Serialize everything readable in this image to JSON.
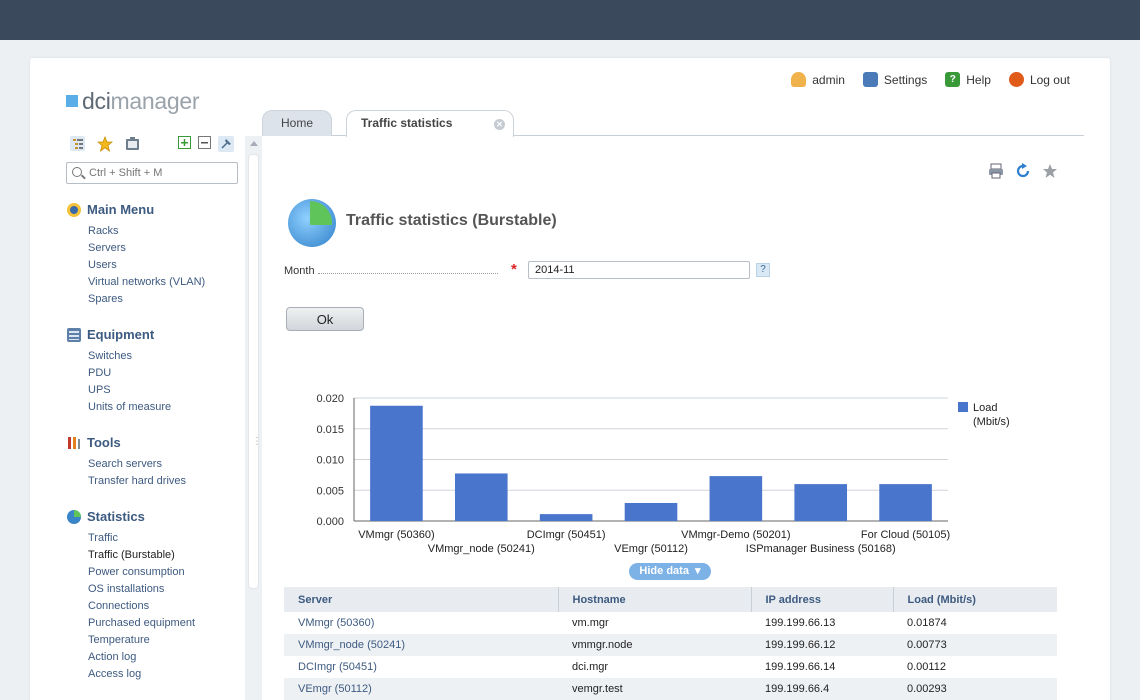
{
  "app": {
    "logo_dci": "dci",
    "logo_manager": "manager"
  },
  "usernav": {
    "user": "admin",
    "settings": "Settings",
    "help": "Help",
    "logout": "Log out"
  },
  "sidebar": {
    "search_placeholder": "Ctrl + Shift + M",
    "groups": [
      {
        "title": "Main Menu",
        "items": [
          "Racks",
          "Servers",
          "Users",
          "Virtual networks (VLAN)",
          "Spares"
        ]
      },
      {
        "title": "Equipment",
        "items": [
          "Switches",
          "PDU",
          "UPS",
          "Units of measure"
        ]
      },
      {
        "title": "Tools",
        "items": [
          "Search servers",
          "Transfer hard drives"
        ]
      },
      {
        "title": "Statistics",
        "items": [
          "Traffic",
          "Traffic (Burstable)",
          "Power consumption",
          "OS installations",
          "Connections",
          "Purchased equipment",
          "Temperature",
          "Action log",
          "Access log"
        ]
      }
    ],
    "active_item": "Traffic (Burstable)"
  },
  "tabs": {
    "home": "Home",
    "current": "Traffic statistics (Burst..."
  },
  "page": {
    "title": "Traffic statistics (Burstable)",
    "month_label": "Month",
    "month_value": "2014-11",
    "help_mark": "?",
    "ok_label": "Ok",
    "hide_data_label": "Hide data"
  },
  "chart_data": {
    "type": "bar",
    "categories": [
      "VMmgr (50360)",
      "VMmgr_node (50241)",
      "DCImgr (50451)",
      "VEmgr (50112)",
      "VMmgr-Demo (50201)",
      "ISPmanager Business (50168)",
      "For Cloud (50105)"
    ],
    "series": [
      {
        "name": "Load (Mbit/s)",
        "values": [
          0.01874,
          0.00773,
          0.00112,
          0.00293,
          0.0073,
          0.006,
          0.006
        ]
      }
    ],
    "yticks": [
      "0.000",
      "0.005",
      "0.010",
      "0.015",
      "0.020"
    ],
    "ylim": [
      0,
      0.02
    ],
    "legend_lines": [
      "Load",
      "(Mbit/s)"
    ],
    "bar_color": "#4a75cc",
    "grid": true,
    "legend_position": "right"
  },
  "table": {
    "headers": [
      "Server",
      "Hostname",
      "IP address",
      "Load (Mbit/s)"
    ],
    "rows": [
      [
        "VMmgr (50360)",
        "vm.mgr",
        "199.199.66.13",
        "0.01874"
      ],
      [
        "VMmgr_node (50241)",
        "vmmgr.node",
        "199.199.66.12",
        "0.00773"
      ],
      [
        "DCImgr (50451)",
        "dci.mgr",
        "199.199.66.14",
        "0.00112"
      ],
      [
        "VEmgr (50112)",
        "vemgr.test",
        "199.199.66.4",
        "0.00293"
      ]
    ]
  }
}
